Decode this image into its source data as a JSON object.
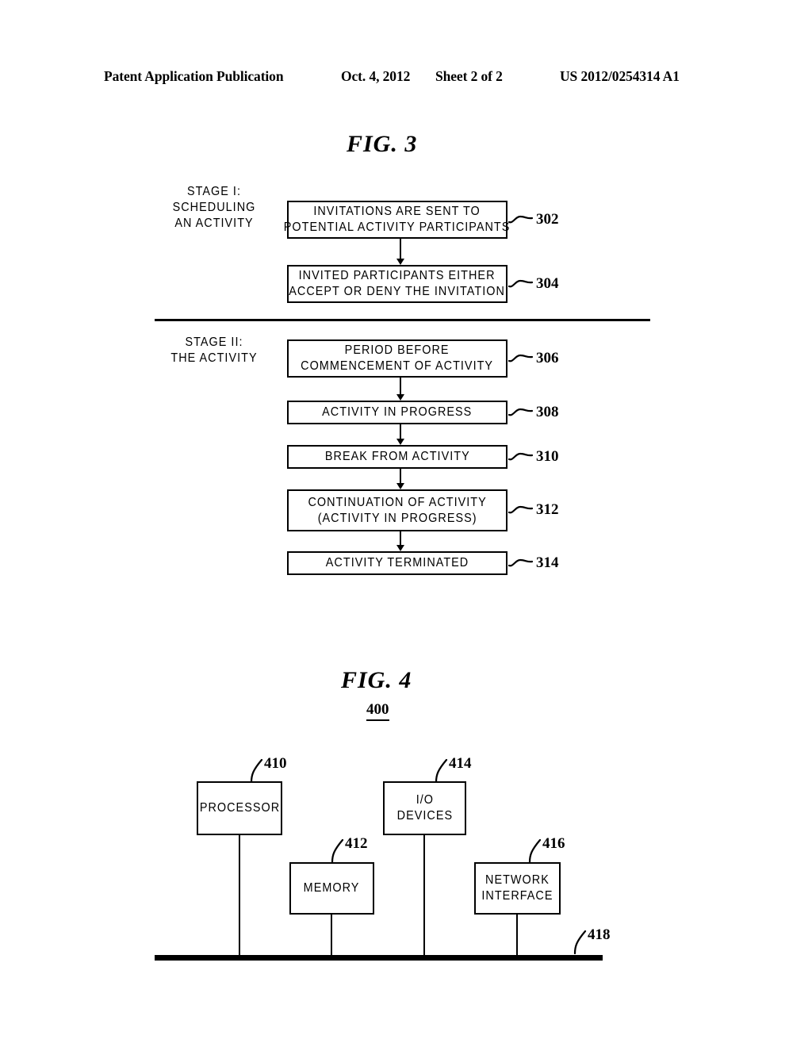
{
  "header": {
    "publication": "Patent Application Publication",
    "date": "Oct. 4, 2012",
    "sheet": "Sheet 2 of 2",
    "patent_number": "US 2012/0254314 A1"
  },
  "figures": [
    {
      "title": "FIG.  3",
      "stages": [
        {
          "label": "STAGE I:\nSCHEDULING\nAN ACTIVITY",
          "line1": "STAGE I:",
          "line2": "SCHEDULING",
          "line3": "AN ACTIVITY"
        },
        {
          "label": "STAGE II:\nTHE ACTIVITY",
          "line1": "STAGE II:",
          "line2": "THE ACTIVITY"
        }
      ],
      "boxes": [
        {
          "ref": "302",
          "line1": "INVITATIONS ARE SENT TO",
          "line2": "POTENTIAL ACTIVITY PARTICIPANTS"
        },
        {
          "ref": "304",
          "line1": "INVITED PARTICIPANTS EITHER",
          "line2": "ACCEPT OR DENY THE INVITATION"
        },
        {
          "ref": "306",
          "line1": "PERIOD BEFORE",
          "line2": "COMMENCEMENT OF ACTIVITY"
        },
        {
          "ref": "308",
          "line1": "ACTIVITY IN PROGRESS",
          "line2": ""
        },
        {
          "ref": "310",
          "line1": "BREAK FROM ACTIVITY",
          "line2": ""
        },
        {
          "ref": "312",
          "line1": "CONTINUATION OF ACTIVITY",
          "line2": "(ACTIVITY IN PROGRESS)"
        },
        {
          "ref": "314",
          "line1": "ACTIVITY TERMINATED",
          "line2": ""
        }
      ]
    },
    {
      "title": "FIG.  4",
      "figure_ref": "400",
      "boxes": [
        {
          "ref": "410",
          "line1": "PROCESSOR",
          "line2": ""
        },
        {
          "ref": "412",
          "line1": "MEMORY",
          "line2": ""
        },
        {
          "ref": "414",
          "line1": "I/O",
          "line2": "DEVICES"
        },
        {
          "ref": "416",
          "line1": "NETWORK",
          "line2": "INTERFACE"
        }
      ],
      "bus": {
        "ref": "418"
      }
    }
  ],
  "colors": {
    "ink": "#000000",
    "paper": "#ffffff"
  }
}
